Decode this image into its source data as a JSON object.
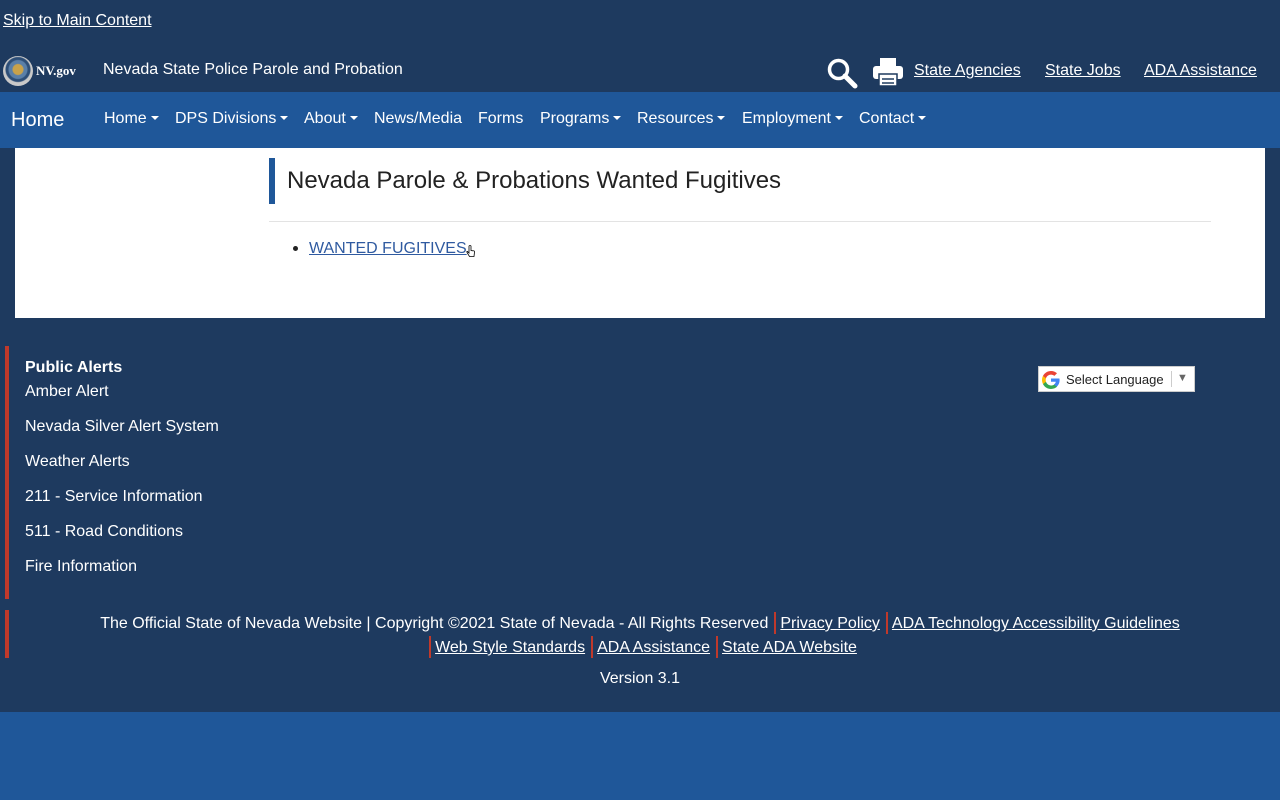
{
  "header": {
    "skip_link": "Skip to Main Content",
    "logo_text": "NV.gov",
    "site_title": "Nevada State Police Parole and Probation",
    "links": [
      "State Agencies",
      "State Jobs",
      "ADA Assistance"
    ]
  },
  "nav": {
    "brand": "Home",
    "items": [
      {
        "label": "Home",
        "dropdown": true
      },
      {
        "label": "DPS Divisions",
        "dropdown": true
      },
      {
        "label": "About",
        "dropdown": true
      },
      {
        "label": "News/Media",
        "dropdown": false
      },
      {
        "label": "Forms",
        "dropdown": false
      },
      {
        "label": "Programs",
        "dropdown": true
      },
      {
        "label": "Resources",
        "dropdown": true
      },
      {
        "label": "Employment",
        "dropdown": true
      },
      {
        "label": "Contact",
        "dropdown": true
      }
    ]
  },
  "main": {
    "heading": "Nevada Parole & Probations Wanted Fugitives",
    "list": [
      "WANTED FUGITIVES"
    ]
  },
  "footer": {
    "alerts_title": "Public Alerts",
    "alerts": [
      "Amber Alert",
      "Nevada Silver Alert System",
      "Weather Alerts",
      "211 - Service Information",
      "511 - Road Conditions",
      "Fire Information"
    ],
    "language_select": "Select Language",
    "language_arrow": "▼",
    "copyright": "The Official State of Nevada Website | Copyright ©2021 State of Nevada - All Rights Reserved",
    "links": [
      "Privacy Policy",
      "ADA Technology Accessibility Guidelines",
      "Web Style Standards",
      "ADA Assistance",
      "State ADA Website"
    ],
    "version": "Version 3.1"
  },
  "colors": {
    "header_bg": "#1e3a5f",
    "nav_bg": "#1f5799",
    "accent_red": "#c0392b",
    "link_blue": "#2f5aa0"
  }
}
